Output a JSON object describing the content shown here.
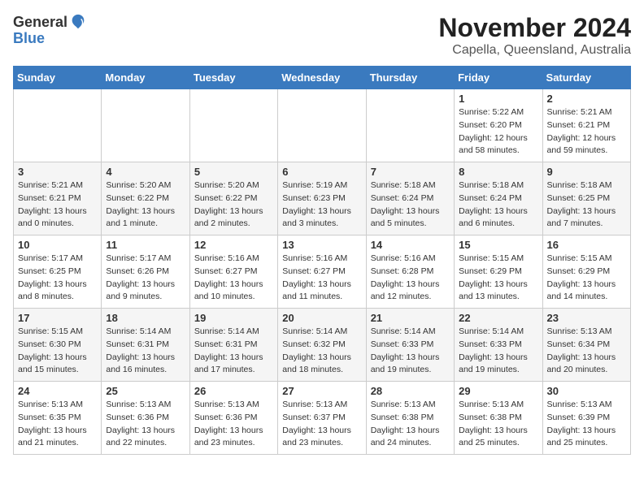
{
  "header": {
    "logo_general": "General",
    "logo_blue": "Blue",
    "month": "November 2024",
    "location": "Capella, Queensland, Australia"
  },
  "weekdays": [
    "Sunday",
    "Monday",
    "Tuesday",
    "Wednesday",
    "Thursday",
    "Friday",
    "Saturday"
  ],
  "rows": [
    [
      {
        "day": "",
        "info": ""
      },
      {
        "day": "",
        "info": ""
      },
      {
        "day": "",
        "info": ""
      },
      {
        "day": "",
        "info": ""
      },
      {
        "day": "",
        "info": ""
      },
      {
        "day": "1",
        "info": "Sunrise: 5:22 AM\nSunset: 6:20 PM\nDaylight: 12 hours\nand 58 minutes."
      },
      {
        "day": "2",
        "info": "Sunrise: 5:21 AM\nSunset: 6:21 PM\nDaylight: 12 hours\nand 59 minutes."
      }
    ],
    [
      {
        "day": "3",
        "info": "Sunrise: 5:21 AM\nSunset: 6:21 PM\nDaylight: 13 hours\nand 0 minutes."
      },
      {
        "day": "4",
        "info": "Sunrise: 5:20 AM\nSunset: 6:22 PM\nDaylight: 13 hours\nand 1 minute."
      },
      {
        "day": "5",
        "info": "Sunrise: 5:20 AM\nSunset: 6:22 PM\nDaylight: 13 hours\nand 2 minutes."
      },
      {
        "day": "6",
        "info": "Sunrise: 5:19 AM\nSunset: 6:23 PM\nDaylight: 13 hours\nand 3 minutes."
      },
      {
        "day": "7",
        "info": "Sunrise: 5:18 AM\nSunset: 6:24 PM\nDaylight: 13 hours\nand 5 minutes."
      },
      {
        "day": "8",
        "info": "Sunrise: 5:18 AM\nSunset: 6:24 PM\nDaylight: 13 hours\nand 6 minutes."
      },
      {
        "day": "9",
        "info": "Sunrise: 5:18 AM\nSunset: 6:25 PM\nDaylight: 13 hours\nand 7 minutes."
      }
    ],
    [
      {
        "day": "10",
        "info": "Sunrise: 5:17 AM\nSunset: 6:25 PM\nDaylight: 13 hours\nand 8 minutes."
      },
      {
        "day": "11",
        "info": "Sunrise: 5:17 AM\nSunset: 6:26 PM\nDaylight: 13 hours\nand 9 minutes."
      },
      {
        "day": "12",
        "info": "Sunrise: 5:16 AM\nSunset: 6:27 PM\nDaylight: 13 hours\nand 10 minutes."
      },
      {
        "day": "13",
        "info": "Sunrise: 5:16 AM\nSunset: 6:27 PM\nDaylight: 13 hours\nand 11 minutes."
      },
      {
        "day": "14",
        "info": "Sunrise: 5:16 AM\nSunset: 6:28 PM\nDaylight: 13 hours\nand 12 minutes."
      },
      {
        "day": "15",
        "info": "Sunrise: 5:15 AM\nSunset: 6:29 PM\nDaylight: 13 hours\nand 13 minutes."
      },
      {
        "day": "16",
        "info": "Sunrise: 5:15 AM\nSunset: 6:29 PM\nDaylight: 13 hours\nand 14 minutes."
      }
    ],
    [
      {
        "day": "17",
        "info": "Sunrise: 5:15 AM\nSunset: 6:30 PM\nDaylight: 13 hours\nand 15 minutes."
      },
      {
        "day": "18",
        "info": "Sunrise: 5:14 AM\nSunset: 6:31 PM\nDaylight: 13 hours\nand 16 minutes."
      },
      {
        "day": "19",
        "info": "Sunrise: 5:14 AM\nSunset: 6:31 PM\nDaylight: 13 hours\nand 17 minutes."
      },
      {
        "day": "20",
        "info": "Sunrise: 5:14 AM\nSunset: 6:32 PM\nDaylight: 13 hours\nand 18 minutes."
      },
      {
        "day": "21",
        "info": "Sunrise: 5:14 AM\nSunset: 6:33 PM\nDaylight: 13 hours\nand 19 minutes."
      },
      {
        "day": "22",
        "info": "Sunrise: 5:14 AM\nSunset: 6:33 PM\nDaylight: 13 hours\nand 19 minutes."
      },
      {
        "day": "23",
        "info": "Sunrise: 5:13 AM\nSunset: 6:34 PM\nDaylight: 13 hours\nand 20 minutes."
      }
    ],
    [
      {
        "day": "24",
        "info": "Sunrise: 5:13 AM\nSunset: 6:35 PM\nDaylight: 13 hours\nand 21 minutes."
      },
      {
        "day": "25",
        "info": "Sunrise: 5:13 AM\nSunset: 6:36 PM\nDaylight: 13 hours\nand 22 minutes."
      },
      {
        "day": "26",
        "info": "Sunrise: 5:13 AM\nSunset: 6:36 PM\nDaylight: 13 hours\nand 23 minutes."
      },
      {
        "day": "27",
        "info": "Sunrise: 5:13 AM\nSunset: 6:37 PM\nDaylight: 13 hours\nand 23 minutes."
      },
      {
        "day": "28",
        "info": "Sunrise: 5:13 AM\nSunset: 6:38 PM\nDaylight: 13 hours\nand 24 minutes."
      },
      {
        "day": "29",
        "info": "Sunrise: 5:13 AM\nSunset: 6:38 PM\nDaylight: 13 hours\nand 25 minutes."
      },
      {
        "day": "30",
        "info": "Sunrise: 5:13 AM\nSunset: 6:39 PM\nDaylight: 13 hours\nand 25 minutes."
      }
    ]
  ]
}
